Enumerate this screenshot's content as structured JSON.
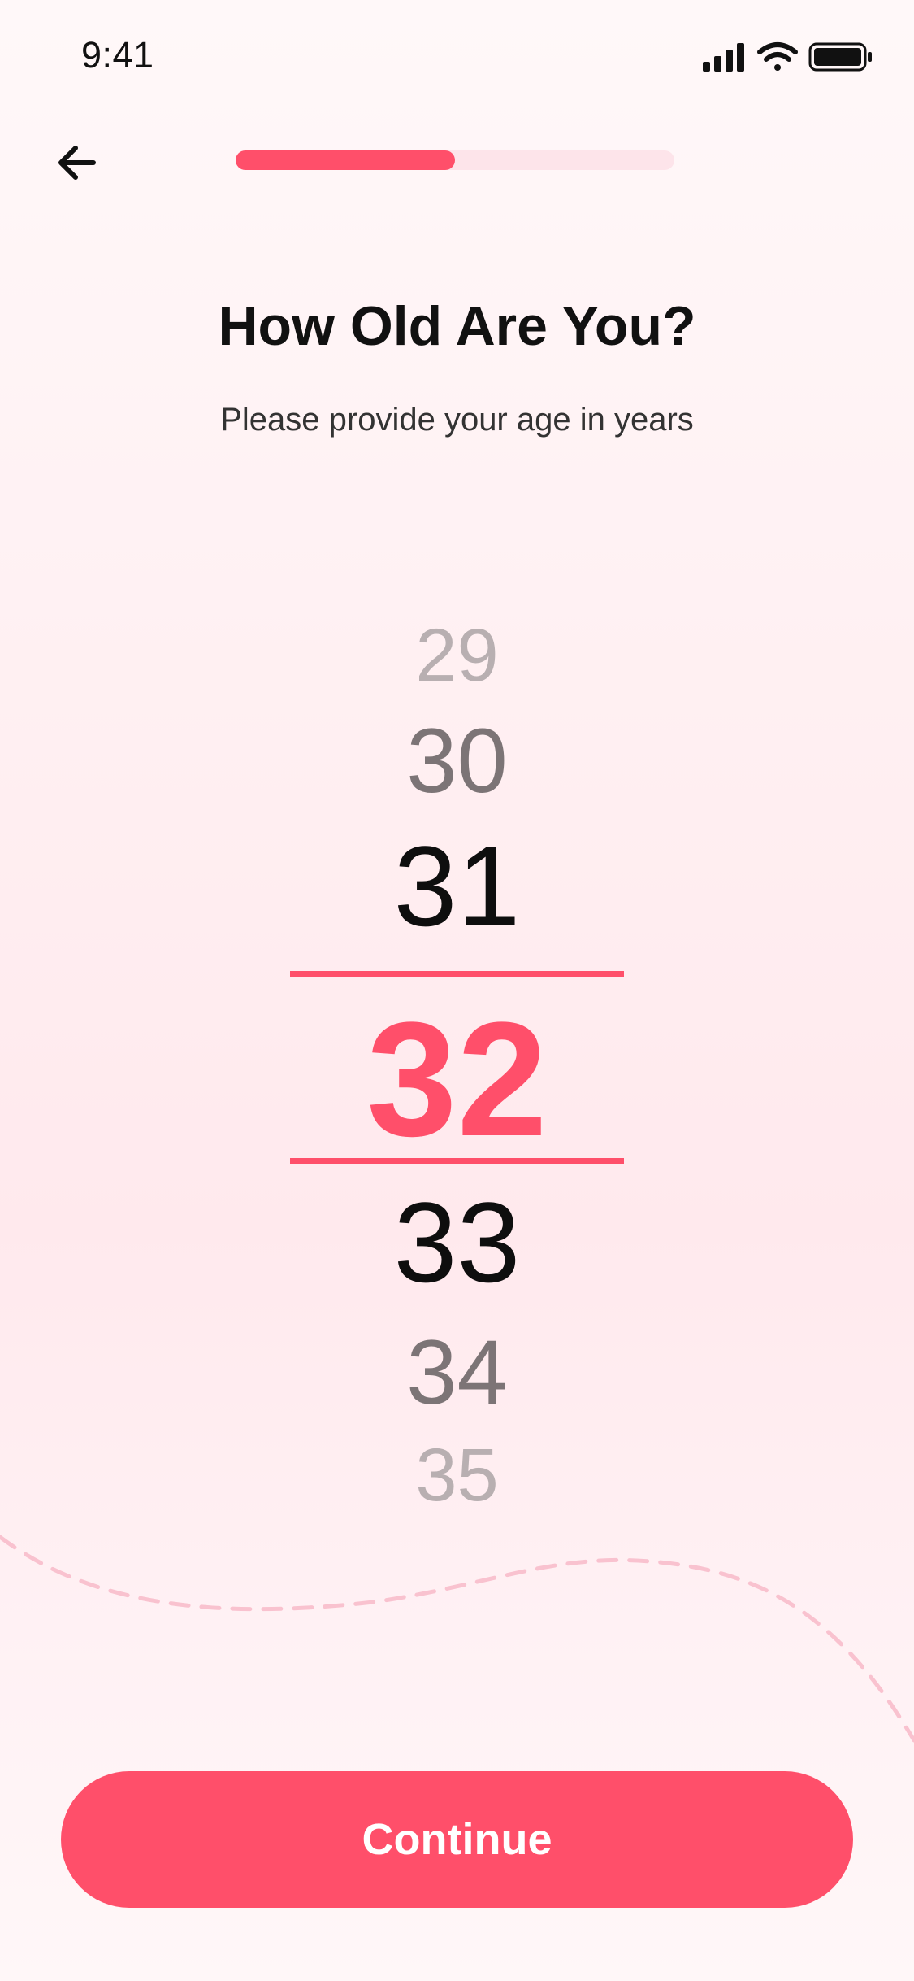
{
  "status_bar": {
    "time": "9:41",
    "icons": [
      "cellular-signal-icon",
      "wifi-icon",
      "battery-icon"
    ]
  },
  "header": {
    "back_icon": "arrow-left-icon",
    "progress_fraction": 0.5
  },
  "main": {
    "title": "How Old Are You?",
    "subtitle": "Please provide your age in years"
  },
  "picker": {
    "options": [
      "29",
      "30",
      "31",
      "32",
      "33",
      "34",
      "35"
    ],
    "selected": "32"
  },
  "footer": {
    "continue_label": "Continue"
  },
  "colors": {
    "accent": "#ff4f6a",
    "progress_track": "#fde4ea",
    "text_primary": "#111111",
    "text_faded": "#b8afb1",
    "text_mid": "#7c7476"
  }
}
